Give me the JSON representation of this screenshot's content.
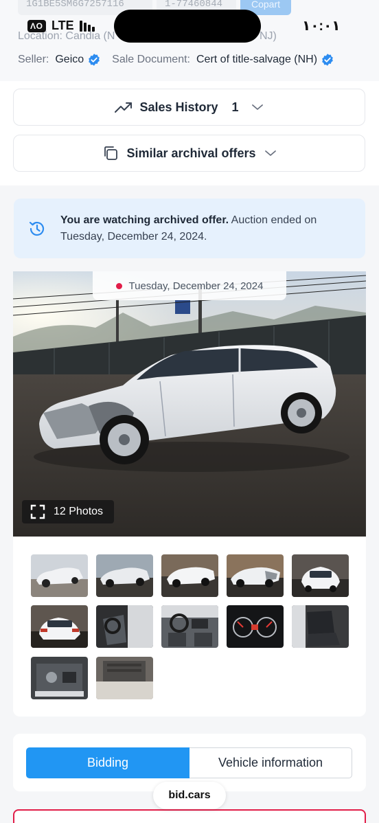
{
  "status_bar": {
    "network_badge": "ΛΟ",
    "network": "LTE",
    "time": "١٠:٠١"
  },
  "vehicle_header": {
    "vin": "1G1BE5SM6G7257116",
    "lot": "1-77460844",
    "auction": "Copart",
    "location_label": "Location:",
    "location_value": "Candia (N",
    "location_tail": "NJ)",
    "seller_label": "Seller:",
    "seller_value": "Geico",
    "document_label": "Sale Document:",
    "document_value": "Cert of title-salvage (NH)"
  },
  "sales_history": {
    "label": "Sales History",
    "count": "1"
  },
  "similar_offers": {
    "label": "Similar archival offers"
  },
  "notice": {
    "bold": "You are watching archived offer.",
    "text": " Auction ended on Tuesday, December 24, 2024."
  },
  "main_photo": {
    "date": "Tuesday, December 24, 2024",
    "photos_count_label": "12 Photos"
  },
  "thumbnails": {
    "count": 12
  },
  "tabs": {
    "bidding": "Bidding",
    "vehicle_info": "Vehicle information",
    "active": "Bidding"
  },
  "browser": {
    "url": "bid.cars"
  },
  "colors": {
    "accent": "#2196f3",
    "verified": "#2d8cf0",
    "notice_bg": "#e6f1fd",
    "danger": "#e11d48"
  },
  "icons": [
    "trending-up-icon",
    "chevron-down-icon",
    "copy-icon",
    "history-icon",
    "verified-check-icon",
    "expand-icon"
  ]
}
